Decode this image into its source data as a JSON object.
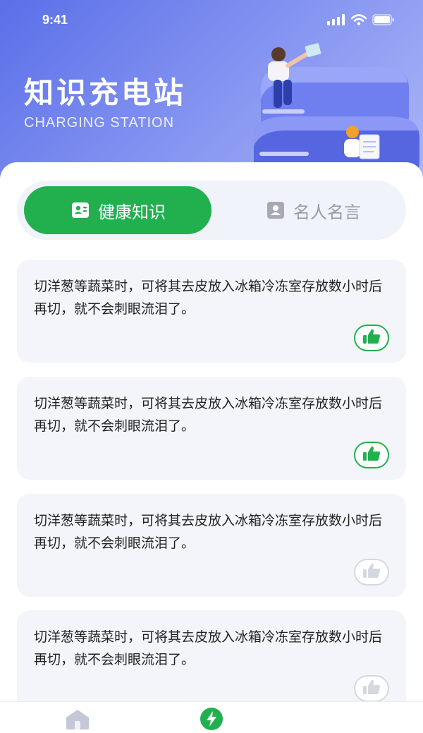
{
  "status_bar": {
    "time": "9:41"
  },
  "header": {
    "title": "知识充电站",
    "subtitle": "CHARGING STATION"
  },
  "tabs": [
    {
      "label": "健康知识",
      "active": true,
      "icon": "id-card-icon"
    },
    {
      "label": "名人名言",
      "active": false,
      "icon": "contact-icon"
    }
  ],
  "cards": [
    {
      "text": "切洋葱等蔬菜时，可将其去皮放入冰箱冷冻室存放数小时后再切，就不会刺眼流泪了。",
      "liked": true
    },
    {
      "text": "切洋葱等蔬菜时，可将其去皮放入冰箱冷冻室存放数小时后再切，就不会刺眼流泪了。",
      "liked": true
    },
    {
      "text": "切洋葱等蔬菜时，可将其去皮放入冰箱冷冻室存放数小时后再切，就不会刺眼流泪了。",
      "liked": false
    },
    {
      "text": "切洋葱等蔬菜时，可将其去皮放入冰箱冷冻室存放数小时后再切，就不会刺眼流泪了。",
      "liked": false
    }
  ],
  "tabbar": [
    {
      "icon": "home-icon",
      "active": false
    },
    {
      "icon": "lightning-icon",
      "active": true
    }
  ],
  "colors": {
    "accent": "#22b04f",
    "header_start": "#5b6fe8",
    "header_end": "#aab6f6",
    "card_bg": "#f3f5fb"
  }
}
